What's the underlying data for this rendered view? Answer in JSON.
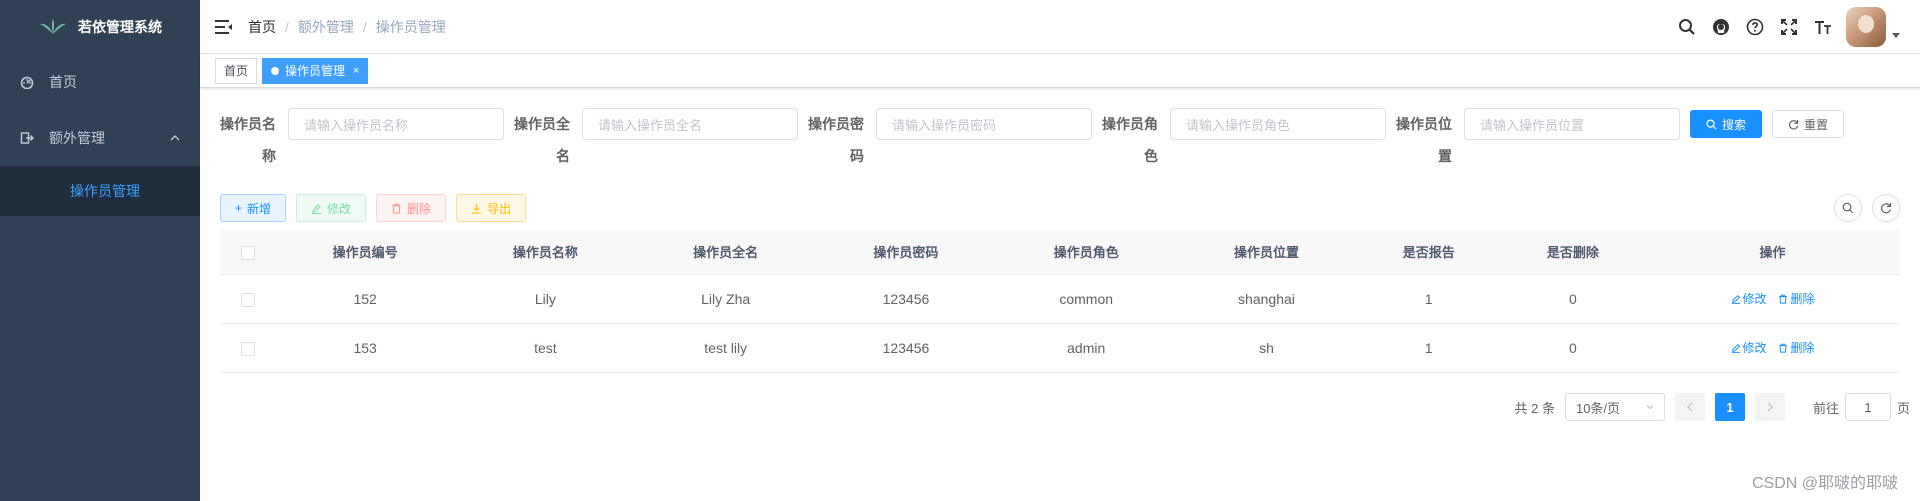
{
  "app": {
    "title": "若依管理系统",
    "colors": {
      "sidebar_bg": "#304156",
      "sidebar_active_text": "#409eff",
      "primary": "#1890ff"
    }
  },
  "sidebar": {
    "items": [
      {
        "label": "首页",
        "icon": "dashboard-icon"
      },
      {
        "label": "额外管理",
        "icon": "logout-icon",
        "expanded": true,
        "children": [
          {
            "label": "操作员管理",
            "active": true
          }
        ]
      }
    ]
  },
  "breadcrumb": [
    "首页",
    "额外管理",
    "操作员管理"
  ],
  "tags": [
    {
      "label": "首页",
      "active": false
    },
    {
      "label": "操作员管理",
      "active": true,
      "close": "×"
    }
  ],
  "search": {
    "fields": [
      {
        "label": "操作员名称",
        "placeholder": "请输入操作员名称"
      },
      {
        "label": "操作员全名",
        "placeholder": "请输入操作员全名"
      },
      {
        "label": "操作员密码",
        "placeholder": "请输入操作员密码"
      },
      {
        "label": "操作员角色",
        "placeholder": "请输入操作员角色"
      },
      {
        "label": "操作员位置",
        "placeholder": "请输入操作员位置"
      }
    ],
    "search_label": "搜索",
    "reset_label": "重置"
  },
  "toolbar": {
    "add_label": "新增",
    "edit_label": "修改",
    "delete_label": "删除",
    "export_label": "导出"
  },
  "table": {
    "columns": [
      "操作员编号",
      "操作员名称",
      "操作员全名",
      "操作员密码",
      "操作员角色",
      "操作员位置",
      "是否报告",
      "是否删除",
      "操作"
    ],
    "rows": [
      [
        "152",
        "Lily",
        "Lily Zha",
        "123456",
        "common",
        "shanghai",
        "1",
        "0"
      ],
      [
        "153",
        "test",
        "test lily",
        "123456",
        "admin",
        "sh",
        "1",
        "0"
      ]
    ],
    "row_edit_label": "修改",
    "row_delete_label": "删除"
  },
  "pagination": {
    "total_text": "共 2 条",
    "page_size": "10条/页",
    "current_page": "1",
    "goto_prefix": "前往",
    "goto_value": "1",
    "goto_suffix": "页"
  },
  "watermark": "CSDN @耶啵的耶啵"
}
